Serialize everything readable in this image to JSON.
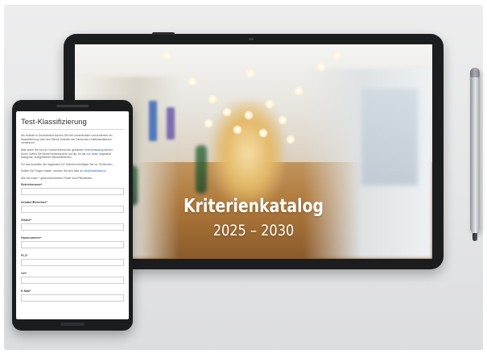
{
  "tablet": {
    "title": "Kriterienkatalog",
    "years": "2025 – 2030"
  },
  "phone": {
    "form_title": "Test-Klassifizierung",
    "intro_lines": [
      "Als Hotelier in Deutschland können Sie hier unverbindlich und kostenlos ein",
      "Klassifizierung nach den Sterne-Kriterien der Deutschen Hotelklassifizierun",
      "vornehmen."
    ],
    "para2_lines": [
      "Bitte lesen Sie sich im Vorfeld einmal den gesamten ",
      "Kriterienkatalog",
      " aufmer",
      "durch. hoffen Sie hierbei insbesondere auf die, für die von Ihnen angestreb",
      "Kategorie, maßgeblichen Mindestkriterien."
    ],
    "para3": "Für das Ausfüllen der insgesamt 247 Kriterien benötigen Sie ca. 30 Minuten",
    "para4_prefix": "Sollten Sie Fragen haben, wenden Sie sich bitte an ",
    "para4_link": "info@hotelstars.eu",
    "para5": "Alle mit einem * gekennzeichneten Felder sind Pflichtfelder.",
    "fields": [
      "Betriebsname*",
      "Inhaber/Betreiber*",
      "Straße*",
      "Hausnummer*",
      "PLZ*",
      "Ort*",
      "E-Mail*"
    ]
  }
}
